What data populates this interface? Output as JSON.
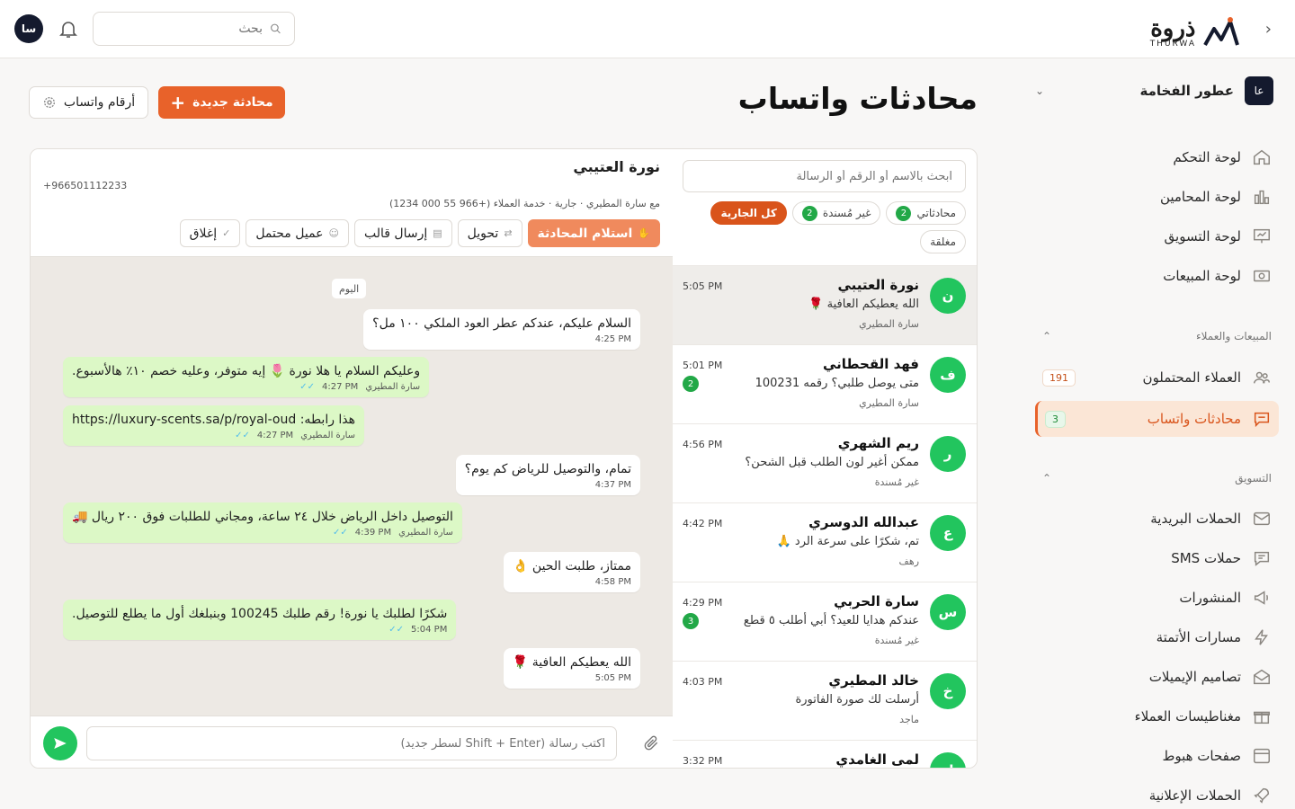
{
  "brand": {
    "name_ar": "ذروة",
    "name_en": "THURWA",
    "accent": "#e8622a",
    "whatsapp_green": "#22c55e"
  },
  "topbar": {
    "search_placeholder": "بحث",
    "user_initials": "سا"
  },
  "workspace": {
    "initials": "عا",
    "name": "عطور الفخامة"
  },
  "nav": {
    "main": [
      {
        "label": "لوحة التحكم",
        "icon": "home-icon"
      },
      {
        "label": "لوحة المحامين",
        "icon": "bar-chart-icon"
      },
      {
        "label": "لوحة التسويق",
        "icon": "presentation-icon"
      },
      {
        "label": "لوحة المبيعات",
        "icon": "cash-icon"
      }
    ],
    "sales_section": "المبيعات والعملاء",
    "sales": [
      {
        "label": "العملاء المحتملون",
        "icon": "users-icon",
        "count": "191"
      },
      {
        "label": "محادثات واتساب",
        "icon": "chat-icon",
        "count": "3"
      }
    ],
    "marketing_section": "التسويق",
    "marketing": [
      {
        "label": "الحملات البريدية",
        "icon": "mail-icon"
      },
      {
        "label": "حملات SMS",
        "icon": "message-icon"
      },
      {
        "label": "المنشورات",
        "icon": "megaphone-icon"
      },
      {
        "label": "مسارات الأتمتة",
        "icon": "bolt-icon"
      },
      {
        "label": "تصاميم الإيميلات",
        "icon": "envelope-open-icon"
      },
      {
        "label": "مغناطيسات العملاء",
        "icon": "gift-icon"
      },
      {
        "label": "صفحات هبوط",
        "icon": "browser-icon"
      },
      {
        "label": "الحملات الإعلانية",
        "icon": "rocket-icon"
      }
    ]
  },
  "page": {
    "title": "محادثات واتساب",
    "new_button": "محادثة جديدة",
    "numbers_button": "أرقام واتساب"
  },
  "conv_list": {
    "search_placeholder": "ابحث بالاسم أو الرقم أو الرسالة",
    "filters": [
      {
        "label": "محادثاتي",
        "count": "2"
      },
      {
        "label": "غير مُسندة",
        "count": "2"
      },
      {
        "label": "كل الجارية",
        "count": ""
      },
      {
        "label": "مغلقة",
        "count": ""
      }
    ],
    "items": [
      {
        "initial": "ن",
        "name": "نورة العتيبي",
        "preview": "الله يعطيكم العافية 🌹",
        "sub": "سارة المطيري",
        "time": "5:05 PM",
        "unread": ""
      },
      {
        "initial": "ف",
        "name": "فهد القحطاني",
        "preview": "متى يوصل طلبي؟ رقمه 100231",
        "sub": "سارة المطيري",
        "time": "5:01 PM",
        "unread": "2"
      },
      {
        "initial": "ر",
        "name": "ريم الشهري",
        "preview": "ممكن أغير لون الطلب قبل الشحن؟",
        "sub": "غير مُسندة",
        "time": "4:56 PM",
        "unread": ""
      },
      {
        "initial": "ع",
        "name": "عبدالله الدوسري",
        "preview": "تم، شكرًا على سرعة الرد 🙏",
        "sub": "رهف",
        "time": "4:42 PM",
        "unread": ""
      },
      {
        "initial": "س",
        "name": "سارة الحربي",
        "preview": "عندكم هدايا للعيد؟ أبي أطلب ٥ قطع",
        "sub": "غير مُسندة",
        "time": "4:29 PM",
        "unread": "3"
      },
      {
        "initial": "خ",
        "name": "خالد المطيري",
        "preview": "أرسلت لك صورة الفاتورة",
        "sub": "ماجد",
        "time": "4:03 PM",
        "unread": ""
      },
      {
        "initial": "ل",
        "name": "لمى الغامدي",
        "preview": "",
        "sub": "",
        "time": "3:32 PM",
        "unread": ""
      }
    ]
  },
  "chat": {
    "name": "نورة العتيبي",
    "phone": "+966501112233",
    "meta": "مع سارة المطيري · جارية · خدمة العملاء (+966 55 000 1234)",
    "actions": {
      "take": "استلام المحادثة",
      "transfer": "تحويل",
      "template": "إرسال قالب",
      "lead": "عميل محتمل",
      "close": "إغلاق"
    },
    "day_label": "اليوم",
    "messages": [
      {
        "dir": "in",
        "text": "السلام عليكم، عندكم عطر العود الملكي ١٠٠ مل؟",
        "time": "4:25 PM",
        "agent": ""
      },
      {
        "dir": "out",
        "text": "وعليكم السلام يا هلا نورة 🌷 إيه متوفر، وعليه خصم ١٠٪ هالأسبوع.",
        "time": "4:27 PM",
        "agent": "سارة المطيري"
      },
      {
        "dir": "out",
        "text": "هذا رابطه: https://luxury-scents.sa/p/royal-oud",
        "time": "4:27 PM",
        "agent": "سارة المطيري"
      },
      {
        "dir": "in",
        "text": "تمام، والتوصيل للرياض كم يوم؟",
        "time": "4:37 PM",
        "agent": ""
      },
      {
        "dir": "out",
        "text": "التوصيل داخل الرياض خلال ٢٤ ساعة، ومجاني للطلبات فوق ٢٠٠ ريال 🚚",
        "time": "4:39 PM",
        "agent": "سارة المطيري"
      },
      {
        "dir": "in",
        "text": "ممتاز، طلبت الحين 👌",
        "time": "4:58 PM",
        "agent": ""
      },
      {
        "dir": "out",
        "text": "شكرًا لطلبك يا نورة! رقم طلبك 100245 وبنبلغك أول ما يطلع للتوصيل.",
        "time": "5:04 PM",
        "agent": ""
      },
      {
        "dir": "in",
        "text": "الله يعطيكم العافية 🌹",
        "time": "5:05 PM",
        "agent": ""
      }
    ],
    "composer_placeholder": "اكتب رسالة (Shift + Enter لسطر جديد)"
  }
}
